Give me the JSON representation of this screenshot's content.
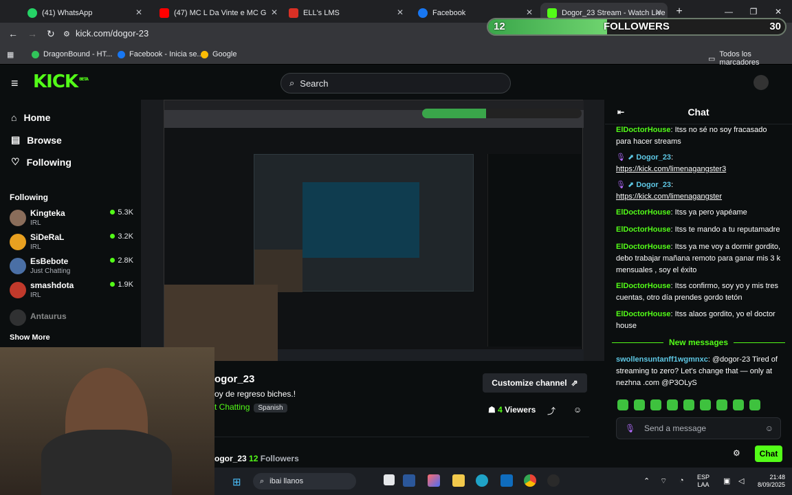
{
  "browser": {
    "tabs": [
      {
        "label": "(41) WhatsApp",
        "color": "#25d366"
      },
      {
        "label": "(47) MC L Da Vinte e MC G",
        "color": "#ff0000"
      },
      {
        "label": "ELL's LMS",
        "color": "#d93025"
      },
      {
        "label": "Facebook",
        "color": "#1877f2"
      },
      {
        "label": "Dogor_23 Stream - Watch Live",
        "color": "#53fc18"
      }
    ],
    "new_tab": "+",
    "url": "kick.com/dogor-23",
    "bookmarks": [
      {
        "label": "DragonBound - HT...",
        "color": "#31c45a"
      },
      {
        "label": "Facebook - Inicia se...",
        "color": "#1877f2"
      },
      {
        "label": "Google",
        "color": "#fbbc05"
      }
    ],
    "all_bookmarks": "Todos los marcadores"
  },
  "overlay": {
    "followers_current": "12",
    "followers_label": "FOLLOWERS",
    "followers_goal": "30",
    "progress": 0.4
  },
  "kick": {
    "logo": "KICK",
    "logo_badge": "BETA",
    "search_placeholder": "Search",
    "nav": {
      "home": "Home",
      "browse": "Browse",
      "following": "Following"
    },
    "following_title": "Following",
    "following": [
      {
        "name": "Kingteka",
        "category": "IRL",
        "viewers": "5.3K",
        "color": "#8a6d5a"
      },
      {
        "name": "SiDeRaL",
        "category": "IRL",
        "viewers": "3.2K",
        "color": "#e8a020"
      },
      {
        "name": "EsBebote",
        "category": "Just Chatting",
        "viewers": "2.8K",
        "color": "#4a6fa5"
      },
      {
        "name": "smashdota",
        "category": "IRL",
        "viewers": "1.9K",
        "color": "#c0392b"
      },
      {
        "name": "Antaurus",
        "category": "",
        "viewers": "",
        "color": "#555555"
      }
    ],
    "show_more": "Show More"
  },
  "stream": {
    "channel": "ogor_23",
    "title": "oy de regreso biches.!",
    "category": "t Chatting",
    "language": "Spanish",
    "customize": "Customize channel",
    "viewers_count": "4",
    "viewers_label": "Viewers",
    "bottom_channel": "ogor_23",
    "followers_count": "12",
    "followers_label": "Followers"
  },
  "chat": {
    "title": "Chat",
    "messages": [
      {
        "user": "ElDoctorHouse",
        "text": "Itss no sé no soy fracasado para hacer streams"
      },
      {
        "user": "Dogor_23",
        "text": "https://kick.com/limenagangster3",
        "link": true
      },
      {
        "user": "Dogor_23",
        "text": "https://kick.com/limenagangster",
        "link": true
      },
      {
        "user": "ElDoctorHouse",
        "text": "Itss ya pero yapéame"
      },
      {
        "user": "ElDoctorHouse",
        "text": "Itss te mando a tu reputamadre"
      },
      {
        "user": "ElDoctorHouse",
        "text": "Itss ya me voy a dormir gordito, debo trabajar mañana remoto para ganar mis 3 k mensuales , soy el éxito"
      },
      {
        "user": "ElDoctorHouse",
        "text": "Itss confirmo, soy yo y mis tres cuentas, otro día prendes gordo tetón"
      },
      {
        "user": "ElDoctorHouse",
        "text": "Itss alaos gordito, yo el doctor house"
      }
    ],
    "new_messages": "New messages",
    "spam": {
      "user": "swollensuntanff1wgmnxc",
      "text": "@dogor-23 Tired of streaming to zero? Let's change that — only at nezhna .com @P3OLyS"
    },
    "placeholder": "Send a message",
    "send": "Chat"
  },
  "taskbar": {
    "search": "ibai llanos",
    "lang": "ESP",
    "lang2": "LAA",
    "time": "21:48",
    "date": "8/09/2025"
  }
}
